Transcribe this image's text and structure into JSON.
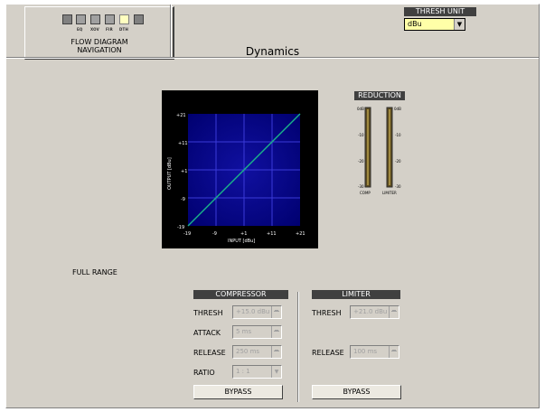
{
  "navigation": {
    "blocks": [
      "EQ",
      "XOV",
      "FIR",
      "DTH"
    ],
    "title_line1": "FLOW DIAGRAM",
    "title_line2": "NAVIGATION"
  },
  "thresh_unit": {
    "label": "THRESH UNIT",
    "value": "dBu"
  },
  "page_title": "Dynamics",
  "graph": {
    "x_label": "INPUT [dBu]",
    "y_label": "OUTPUT [dBu]",
    "ticks": [
      "-19",
      "-9",
      "+1",
      "+11",
      "+21"
    ],
    "colors": {
      "background": "#000080",
      "grid": "#3a3ad8",
      "curve": "#19b48a"
    }
  },
  "reduction": {
    "label": "REDUCTION",
    "left_ticks": [
      "0dB",
      "-10",
      "-20",
      "-30"
    ],
    "right_ticks": [
      "0dB",
      "-10",
      "-20",
      "-30"
    ],
    "comp_label": "COMP",
    "limiter_label": "LIMITER"
  },
  "full_range": "FULL RANGE",
  "compressor": {
    "header": "COMPRESSOR",
    "thresh_label": "THRESH",
    "thresh_value": "+15.0 dBu",
    "attack_label": "ATTACK",
    "attack_value": "5 ms",
    "release_label": "RELEASE",
    "release_value": "250 ms",
    "ratio_label": "RATIO",
    "ratio_value": "1 : 1",
    "bypass": "BYPASS"
  },
  "limiter": {
    "header": "LIMITER",
    "thresh_label": "THRESH",
    "thresh_value": "+21.0 dBu",
    "release_label": "RELEASE",
    "release_value": "100 ms",
    "bypass": "BYPASS"
  }
}
